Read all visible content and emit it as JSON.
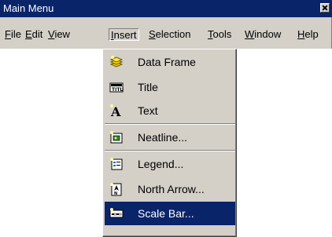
{
  "window": {
    "title": "Main Menu"
  },
  "menubar": [
    {
      "label": "File",
      "underline": "F",
      "rest": "ile"
    },
    {
      "label": "Edit",
      "underline": "E",
      "rest": "dit"
    },
    {
      "label": "View",
      "underline": "V",
      "rest": "iew"
    },
    {
      "label": "Insert",
      "underline": "I",
      "rest": "nsert"
    },
    {
      "label": "Selection",
      "underline": "S",
      "rest": "election"
    },
    {
      "label": "Tools",
      "underline": "T",
      "rest": "ools"
    },
    {
      "label": "Window",
      "underline": "W",
      "rest": "indow"
    },
    {
      "label": "Help",
      "underline": "H",
      "rest": "elp"
    }
  ],
  "active_menu": "Insert",
  "insert_menu": {
    "items": [
      {
        "label": "Data Frame",
        "icon": "data-frame-icon"
      },
      {
        "label": "Title",
        "icon": "title-icon"
      },
      {
        "label": "Text",
        "icon": "text-icon"
      },
      {
        "label": "Neatline...",
        "icon": "neatline-icon"
      },
      {
        "label": "Legend...",
        "icon": "legend-icon"
      },
      {
        "label": "North Arrow...",
        "icon": "north-arrow-icon"
      },
      {
        "label": "Scale Bar...",
        "icon": "scale-bar-icon"
      }
    ],
    "highlighted": "Scale Bar..."
  },
  "colors": {
    "titlebar": "#0a246a",
    "highlight": "#0a246a",
    "face": "#d4d0c8"
  }
}
